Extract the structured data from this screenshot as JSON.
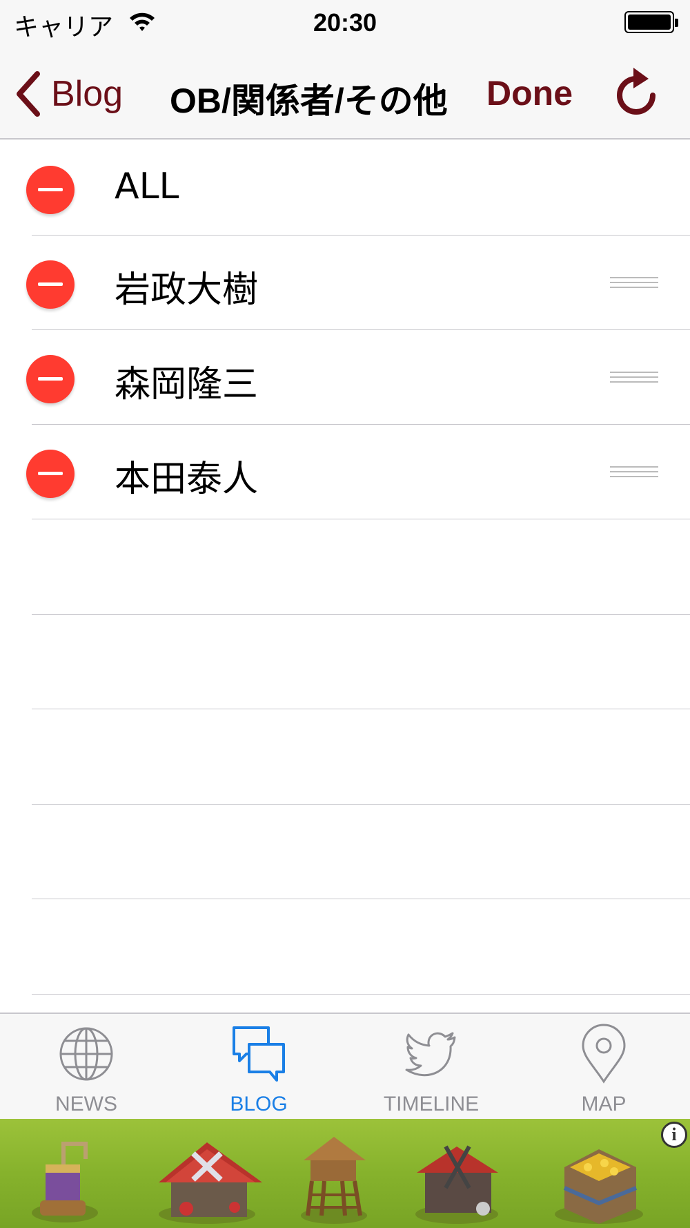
{
  "status_bar": {
    "carrier": "キャリア",
    "time": "20:30",
    "wifi_icon": "wifi-icon",
    "battery_icon": "battery-full-icon"
  },
  "nav": {
    "back_label": "Blog",
    "back_icon": "chevron-left-icon",
    "title": "OB/関係者/その他",
    "done_label": "Done",
    "refresh_icon": "refresh-icon",
    "accent_color": "#6b0f18"
  },
  "list": {
    "items": [
      {
        "label": "ALL",
        "reorderable": false
      },
      {
        "label": "岩政大樹",
        "reorderable": true
      },
      {
        "label": "森岡隆三",
        "reorderable": true
      },
      {
        "label": "本田泰人",
        "reorderable": true
      }
    ],
    "delete_color": "#ff3b30"
  },
  "tabs": [
    {
      "label": "NEWS",
      "icon": "globe-icon",
      "active": false
    },
    {
      "label": "BLOG",
      "icon": "chat-bubbles-icon",
      "active": true
    },
    {
      "label": "TIMELINE",
      "icon": "bird-icon",
      "active": false
    },
    {
      "label": "MAP",
      "icon": "map-pin-icon",
      "active": false
    }
  ],
  "tab_colors": {
    "active": "#1a7fe6",
    "inactive": "#8e8e93"
  },
  "ad": {
    "info_glyph": "i"
  }
}
